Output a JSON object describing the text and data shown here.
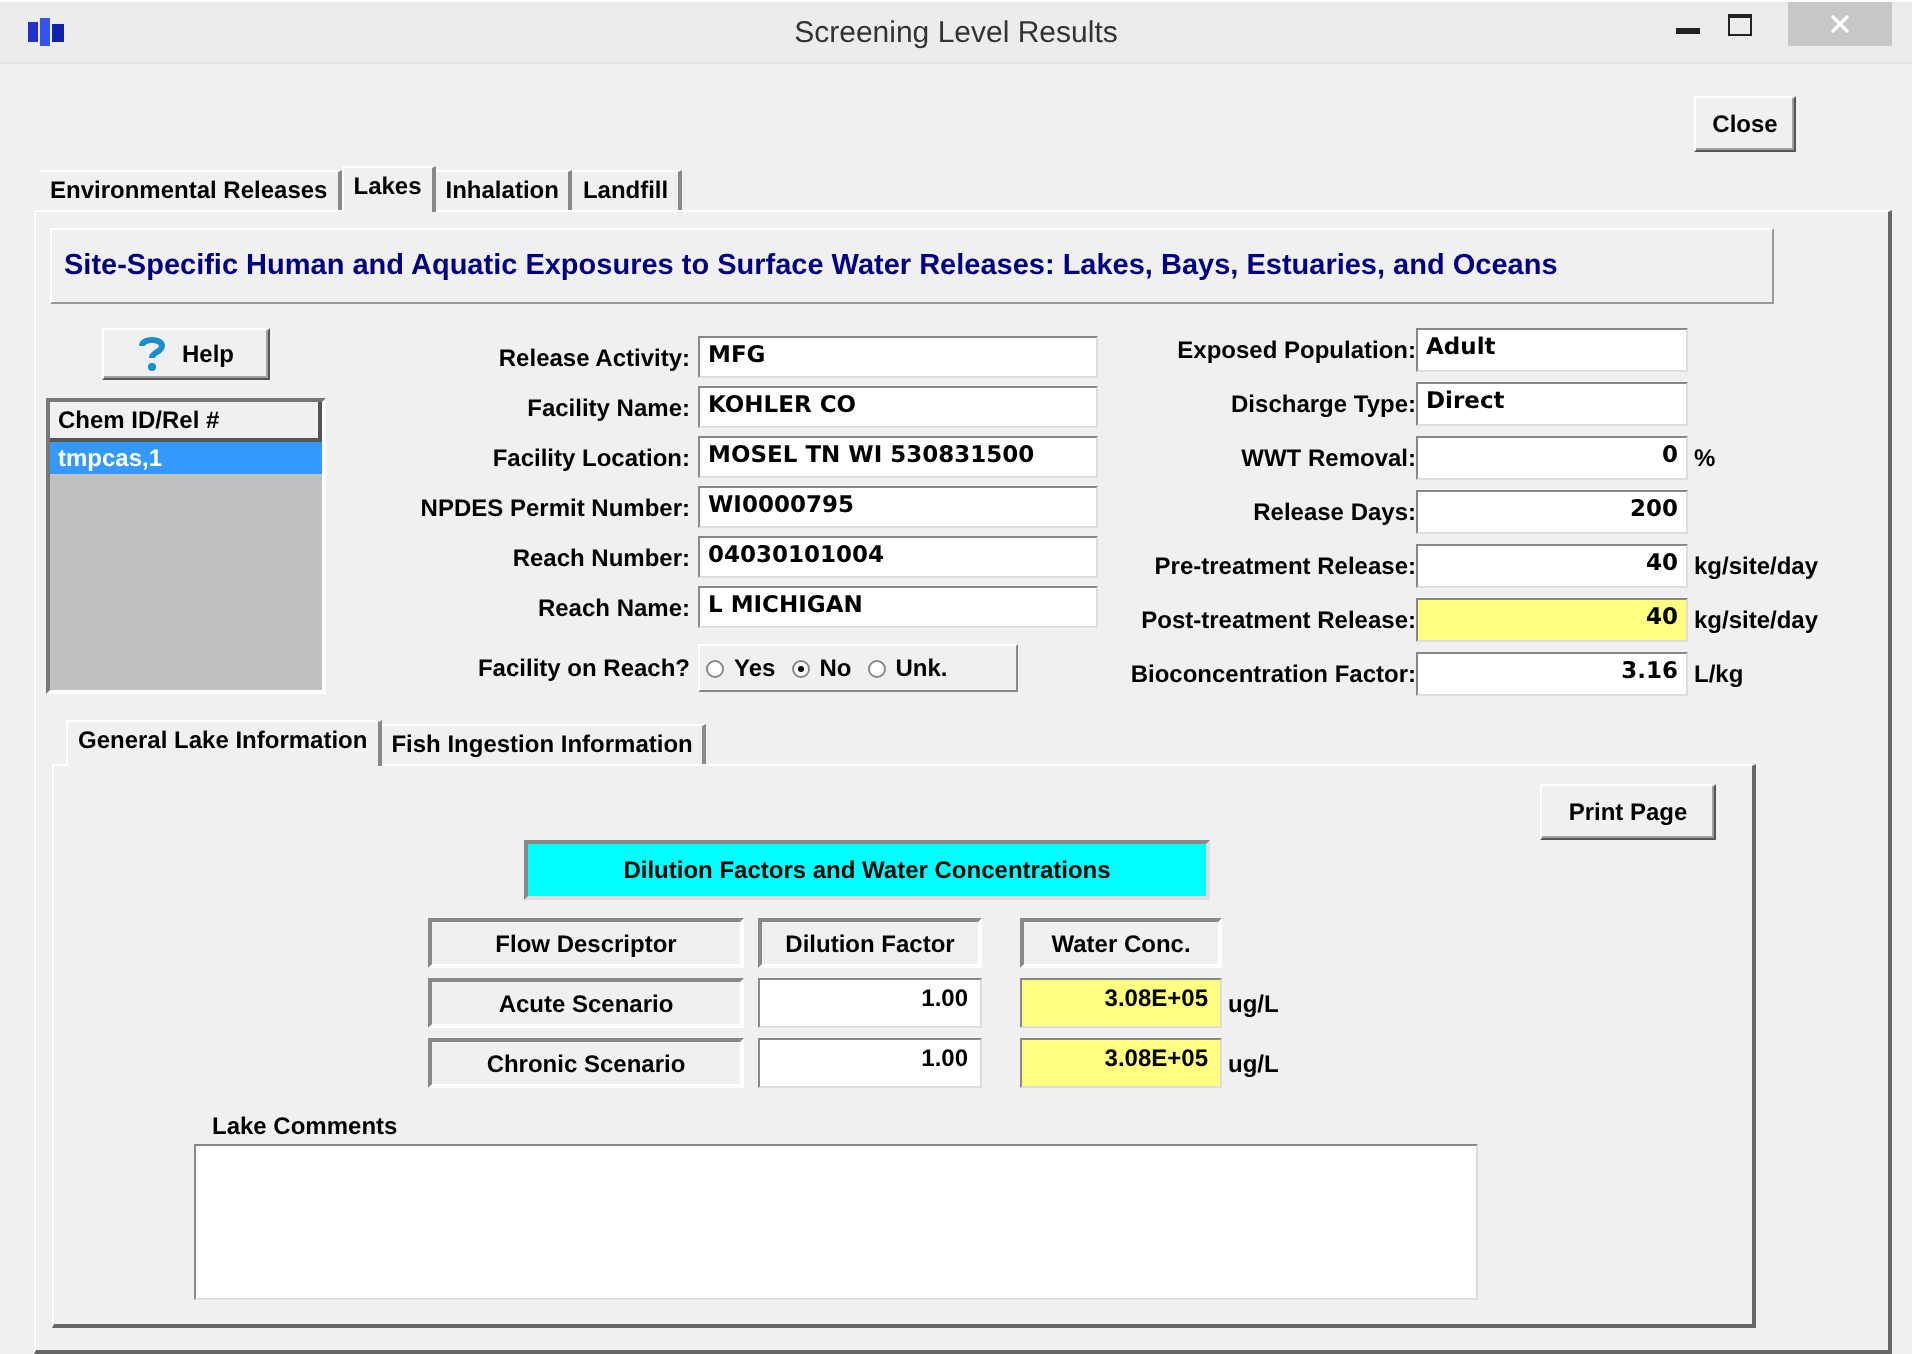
{
  "window": {
    "title": "Screening Level Results"
  },
  "close_button": "Close",
  "tabs": [
    {
      "label": "Environmental Releases",
      "selected": false
    },
    {
      "label": "Lakes",
      "selected": true
    },
    {
      "label": "Inhalation",
      "selected": false
    },
    {
      "label": "Landfill",
      "selected": false
    }
  ],
  "banner": "Site-Specific Human and Aquatic Exposures to Surface Water Releases: Lakes, Bays, Estuaries, and Oceans",
  "help_button": "Help",
  "chem_list": {
    "header": "Chem ID/Rel #",
    "items": [
      {
        "label": "tmpcas,1",
        "selected": true
      }
    ]
  },
  "facility_fields": [
    {
      "label": "Release Activity:",
      "value": "MFG"
    },
    {
      "label": "Facility Name:",
      "value": "KOHLER CO"
    },
    {
      "label": "Facility Location:",
      "value": "MOSEL TN WI 530831500"
    },
    {
      "label": "NPDES Permit Number:",
      "value": "WI0000795"
    },
    {
      "label": "Reach Number:",
      "value": "04030101004"
    },
    {
      "label": "Reach Name:",
      "value": "L MICHIGAN"
    }
  ],
  "facility_on_reach": {
    "label": "Facility on Reach?",
    "options": [
      {
        "label": "Yes",
        "selected": false
      },
      {
        "label": "No",
        "selected": true
      },
      {
        "label": "Unk.",
        "selected": false
      }
    ]
  },
  "exposure_fields": [
    {
      "label": "Exposed Population:",
      "value": "Adult",
      "kind": "text",
      "highlighted": false
    },
    {
      "label": "Discharge Type:",
      "value": "Direct",
      "kind": "text",
      "highlighted": false
    },
    {
      "label": "WWT Removal:",
      "value": "0",
      "kind": "number",
      "unit": "%",
      "highlighted": false
    },
    {
      "label": "Release Days:",
      "value": "200",
      "kind": "number",
      "highlighted": false
    },
    {
      "label": "Pre-treatment Release:",
      "value": "40",
      "kind": "number",
      "unit": "kg/site/day",
      "highlighted": false
    },
    {
      "label": "Post-treatment Release:",
      "value": "40",
      "kind": "number",
      "unit": "kg/site/day",
      "highlighted": true
    },
    {
      "label": "Bioconcentration Factor:",
      "value": "3.16",
      "kind": "number",
      "unit": "L/kg",
      "highlighted": false
    }
  ],
  "sub_tabs": [
    {
      "label": "General Lake Information",
      "selected": true
    },
    {
      "label": "Fish Ingestion Information",
      "selected": false
    }
  ],
  "print_button": "Print Page",
  "section_title": "Dilution Factors and Water Concentrations",
  "table": {
    "columns": [
      "Flow Descriptor",
      "Dilution Factor",
      "Water Conc."
    ],
    "rows": [
      {
        "descriptor": "Acute Scenario",
        "dilution_factor": "1.00",
        "water_conc": "3.08E+05",
        "unit": "ug/L"
      },
      {
        "descriptor": "Chronic Scenario",
        "dilution_factor": "1.00",
        "water_conc": "3.08E+05",
        "unit": "ug/L"
      }
    ]
  },
  "lake_comments": {
    "label": "Lake Comments"
  }
}
